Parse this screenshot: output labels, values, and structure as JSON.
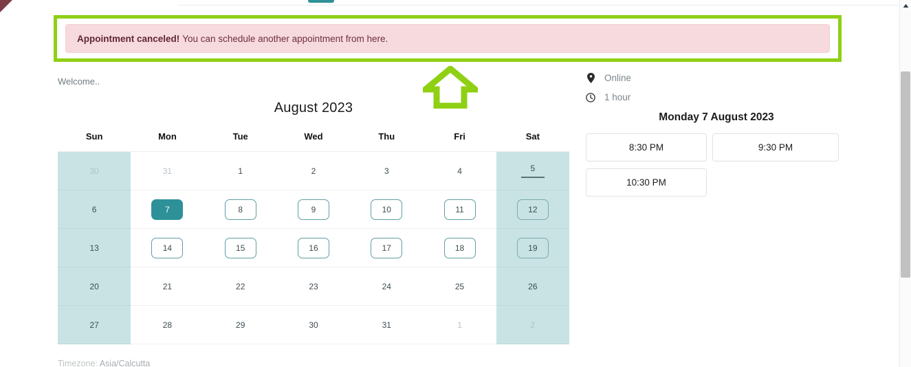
{
  "alert": {
    "strong_text": "Appointment canceled!",
    "message": "You can schedule another appointment from here.",
    "background_color": "#F7DADE",
    "text_color": "#6D2F3A",
    "highlight_border_color": "#8FD014"
  },
  "annotation": {
    "arrow_icon": "arrow-up-icon",
    "color": "#8FD014"
  },
  "welcome": {
    "text": "Welcome.."
  },
  "calendar": {
    "title": "August 2023",
    "weekdays": [
      "Sun",
      "Mon",
      "Tue",
      "Wed",
      "Thu",
      "Fri",
      "Sat"
    ],
    "selected_day": "7",
    "today_day": "5",
    "selected_color": "#2E9199",
    "weekend_background": "#C9E3E4",
    "weeks": [
      [
        {
          "label": "30",
          "state": "muted-weekend"
        },
        {
          "label": "31",
          "state": "muted"
        },
        {
          "label": "1",
          "state": "plain"
        },
        {
          "label": "2",
          "state": "plain"
        },
        {
          "label": "3",
          "state": "plain"
        },
        {
          "label": "4",
          "state": "plain"
        },
        {
          "label": "5",
          "state": "today-weekend"
        }
      ],
      [
        {
          "label": "6",
          "state": "weekend"
        },
        {
          "label": "7",
          "state": "selected"
        },
        {
          "label": "8",
          "state": "available"
        },
        {
          "label": "9",
          "state": "available"
        },
        {
          "label": "10",
          "state": "available"
        },
        {
          "label": "11",
          "state": "available"
        },
        {
          "label": "12",
          "state": "available-weekend"
        }
      ],
      [
        {
          "label": "13",
          "state": "weekend"
        },
        {
          "label": "14",
          "state": "available"
        },
        {
          "label": "15",
          "state": "available"
        },
        {
          "label": "16",
          "state": "available"
        },
        {
          "label": "17",
          "state": "available"
        },
        {
          "label": "18",
          "state": "available"
        },
        {
          "label": "19",
          "state": "available-weekend"
        }
      ],
      [
        {
          "label": "20",
          "state": "weekend"
        },
        {
          "label": "21",
          "state": "plain"
        },
        {
          "label": "22",
          "state": "plain"
        },
        {
          "label": "23",
          "state": "plain"
        },
        {
          "label": "24",
          "state": "plain"
        },
        {
          "label": "25",
          "state": "plain"
        },
        {
          "label": "26",
          "state": "weekend"
        }
      ],
      [
        {
          "label": "27",
          "state": "weekend"
        },
        {
          "label": "28",
          "state": "plain"
        },
        {
          "label": "29",
          "state": "plain"
        },
        {
          "label": "30",
          "state": "plain"
        },
        {
          "label": "31",
          "state": "plain"
        },
        {
          "label": "1",
          "state": "muted"
        },
        {
          "label": "2",
          "state": "muted-weekend"
        }
      ]
    ],
    "footer_label": "Timezone:",
    "footer_value": "Asia/Calcutta"
  },
  "details": {
    "location_icon": "location-pin-icon",
    "location": "Online",
    "duration_icon": "clock-icon",
    "duration": "1 hour",
    "date_heading": "Monday 7 August 2023",
    "slots": [
      "8:30 PM",
      "9:30 PM",
      "10:30 PM"
    ]
  },
  "scrollbar": {
    "up_arrow_icon": "scroll-up-arrow-icon"
  }
}
